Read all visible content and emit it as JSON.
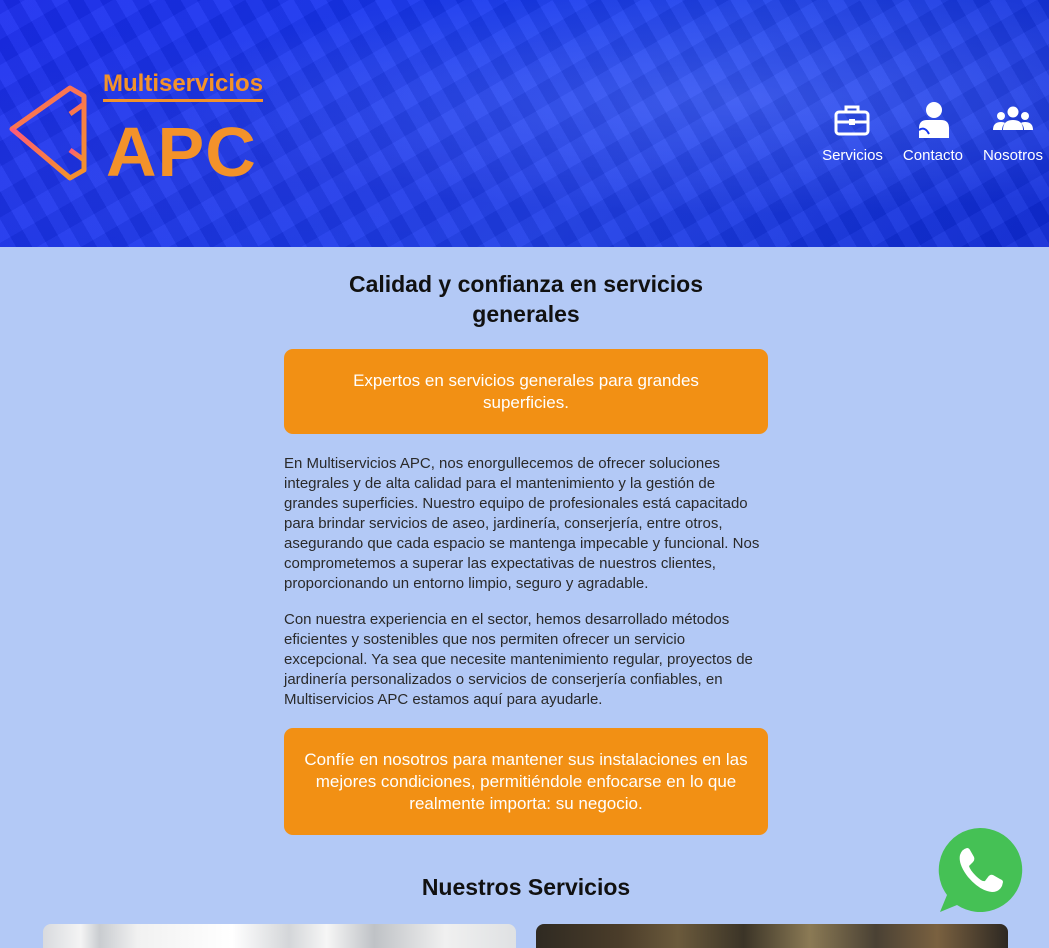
{
  "header": {
    "brand_small": "Multiservicios",
    "brand_big": "APC",
    "nav": [
      {
        "label": "Servicios",
        "icon": "briefcase-icon"
      },
      {
        "label": "Contacto",
        "icon": "user-icon"
      },
      {
        "label": "Nosotros",
        "icon": "users-icon"
      }
    ]
  },
  "main": {
    "headline": "Calidad y confianza en servicios generales",
    "callout_1": "Expertos en servicios generales para grandes superficies.",
    "paragraph_1": "En Multiservicios APC, nos enorgullecemos de ofrecer soluciones integrales y de alta calidad para el mantenimiento y la gestión de grandes superficies. Nuestro equipo de profesionales está capacitado para brindar servicios de aseo, jardinería, conserjería, entre otros, asegurando que cada espacio se mantenga impecable y funcional. Nos comprometemos a superar las expectativas de nuestros clientes, proporcionando un entorno limpio, seguro y agradable.",
    "paragraph_2": "Con nuestra experiencia en el sector, hemos desarrollado métodos eficientes y sostenibles que nos permiten ofrecer un servicio excepcional. Ya sea que necesite mantenimiento regular, proyectos de jardinería personalizados o servicios de conserjería confiables, en Multiservicios APC estamos aquí para ayudarle.",
    "callout_2": "Confíe en nosotros para mantener sus instalaciones en las mejores condiciones, permitiéndole enfocarse en lo que realmente importa: su negocio."
  },
  "services": {
    "title": "Nuestros Servicios"
  },
  "colors": {
    "accent": "#f29014",
    "header_blue": "#1537ee",
    "page_bg": "#b3c9f6",
    "whatsapp": "#45c155"
  }
}
